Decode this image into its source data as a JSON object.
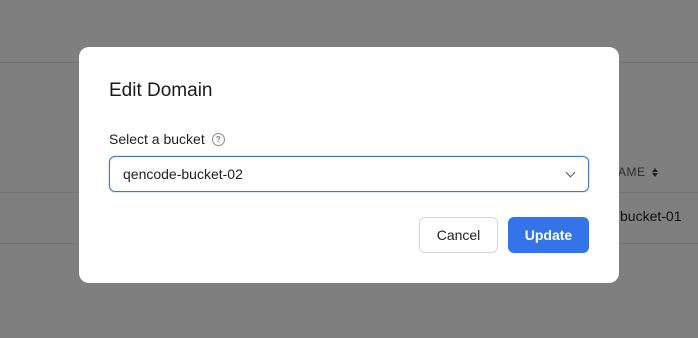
{
  "background": {
    "column_header": "AME",
    "row_cell": "bucket-01"
  },
  "modal": {
    "title": "Edit Domain",
    "field_label": "Select a bucket",
    "help_icon": "question-circle-icon",
    "select_value": "qencode-bucket-02",
    "cancel_label": "Cancel",
    "update_label": "Update"
  },
  "colors": {
    "accent": "#3574e8",
    "overlay": "rgba(0,0,0,0.5)"
  }
}
